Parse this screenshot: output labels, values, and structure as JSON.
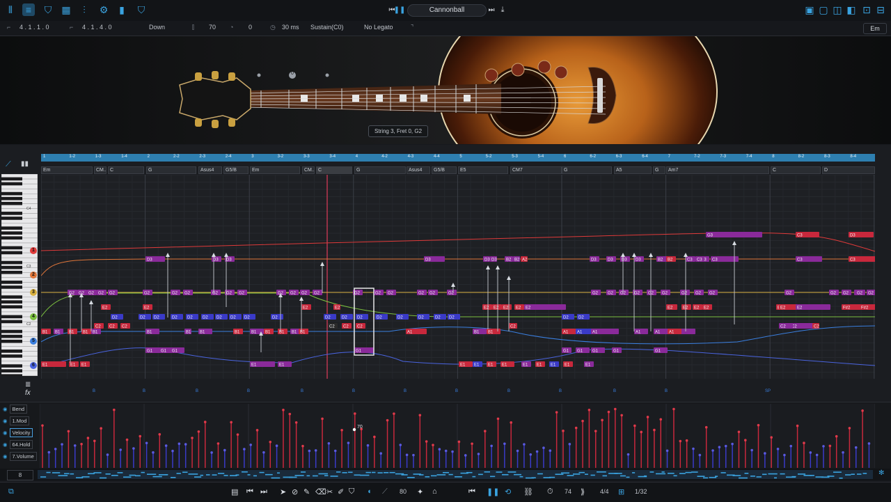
{
  "transport": {
    "song_title": "Cannonball"
  },
  "params": {
    "start_position": "4 . 1 . 1 . 0",
    "length": "4 . 1 . 4 . 0",
    "stroke_direction": "Down",
    "velocity": "70",
    "offset": "0",
    "duration": "30 ms",
    "sustain": "Sustain(C0)",
    "legato": "No Legato",
    "key": "Em"
  },
  "guitar": {
    "fret_info": "String 3, Fret 0, G2",
    "position_marker": "0"
  },
  "ruler": {
    "bars": [
      "1",
      "1-2",
      "1-3",
      "1-4",
      "2",
      "2-2",
      "2-3",
      "2-4",
      "3",
      "3-2",
      "3-3",
      "3-4",
      "4",
      "4-2",
      "4-3",
      "4-4",
      "5",
      "5-2",
      "5-3",
      "5-4",
      "6",
      "6-2",
      "6-3",
      "6-4",
      "7",
      "7-2",
      "7-3",
      "7-4",
      "8",
      "8-2",
      "8-3",
      "8-4"
    ]
  },
  "chords": [
    "Em",
    "CM...",
    "C",
    "G",
    "Asus4",
    "G5/B",
    "Em",
    "CM...",
    "C",
    "G",
    "Asus4",
    "G5/B",
    "E5",
    "CM7",
    "G",
    "A5",
    "G",
    "Am7",
    "C",
    "D"
  ],
  "piano": {
    "octave_labels": [
      "C4",
      "C3",
      "C2"
    ]
  },
  "strings": [
    {
      "num": "1",
      "color": "#e03a3a"
    },
    {
      "num": "2",
      "color": "#e0763a"
    },
    {
      "num": "3",
      "color": "#d8b040"
    },
    {
      "num": "4",
      "color": "#7cc040"
    },
    {
      "num": "5",
      "color": "#3a7fe0"
    },
    {
      "num": "6",
      "color": "#4a64e0"
    }
  ],
  "notes": {
    "string1_row": [
      "G3",
      "C3",
      "D3"
    ],
    "string2_row": [
      "D3",
      "D3",
      "D3",
      "D3",
      "D3",
      "D3",
      "D3",
      "D3",
      "D3",
      "D3",
      "B2",
      "B2",
      "A2",
      "B2",
      "B2",
      "C3",
      "C3",
      "C3",
      "C3",
      "C3",
      "C3"
    ],
    "string3_row": [
      "G2",
      "G2",
      "G2",
      "G2",
      "G2",
      "G2",
      "G2",
      "G2",
      "G2",
      "G2",
      "G2",
      "G2",
      "G2",
      "G2",
      "G2",
      "G2",
      "G2",
      "G2",
      "G2",
      "G2",
      "G2",
      "G2",
      "G2",
      "G2",
      "G2",
      "G2",
      "G2",
      "G2",
      "G2",
      "G2",
      "G2",
      "G2",
      "G2",
      "G2",
      "G2",
      "G2",
      "G2"
    ],
    "string4_row": [
      "E2",
      "E2",
      "E2",
      "E2",
      "E2",
      "E2",
      "E2",
      "E2",
      "E2",
      "E2",
      "E2",
      "E2",
      "E2",
      "E2",
      "F#2",
      "F#2",
      "E2",
      "E2"
    ],
    "string5_row": [
      "D2",
      "D2",
      "D2",
      "D2",
      "D2",
      "D2",
      "D2",
      "D2",
      "D2",
      "D2",
      "D2",
      "D2",
      "D2",
      "D2",
      "D2",
      "D2",
      "D2",
      "D2",
      "D2",
      "D2"
    ],
    "string6_row": [
      "C2",
      "C2",
      "C2",
      "C2",
      "C2",
      "C2",
      "C2",
      "C2",
      "C2",
      "C2"
    ],
    "string7_row": [
      "B1",
      "B1",
      "B1",
      "B1",
      "B1",
      "B1",
      "B1",
      "B1",
      "B1",
      "B1",
      "B1",
      "B1",
      "B1",
      "B1",
      "B1",
      "B1",
      "A1",
      "A1",
      "A1",
      "A1",
      "A1",
      "A1",
      "A1"
    ],
    "string8_row": [
      "G1",
      "G1",
      "G1",
      "G1",
      "G1",
      "G1",
      "G1",
      "G1",
      "G1"
    ],
    "string9_row": [
      "E1",
      "E1",
      "E1",
      "E1",
      "E1",
      "E1",
      "E1",
      "E1",
      "E1",
      "E1",
      "E1",
      "E1",
      "E1",
      "E1"
    ]
  },
  "fx_marks": [
    "B",
    "B",
    "B",
    "B",
    "B",
    "B",
    "B",
    "B",
    "B",
    "B",
    "B",
    "B",
    "B",
    "B",
    "B",
    "B",
    "B",
    "SP"
  ],
  "controllers": [
    "Bend",
    "1.Mod",
    "Velocity",
    "64.Hold",
    "7.Volume"
  ],
  "velocity_cursor_value": "70",
  "overview": {
    "zoom": "8"
  },
  "bottom": {
    "step": "80",
    "tempo": "74",
    "time_signature": "4/4",
    "quantize": "1/32"
  },
  "colors": {
    "accent": "#3aa3e0",
    "playhead": "#e03a5a",
    "note_red": "#c8283c",
    "note_purple": "#8a2a9a",
    "note_blue": "#3a3ac8"
  }
}
